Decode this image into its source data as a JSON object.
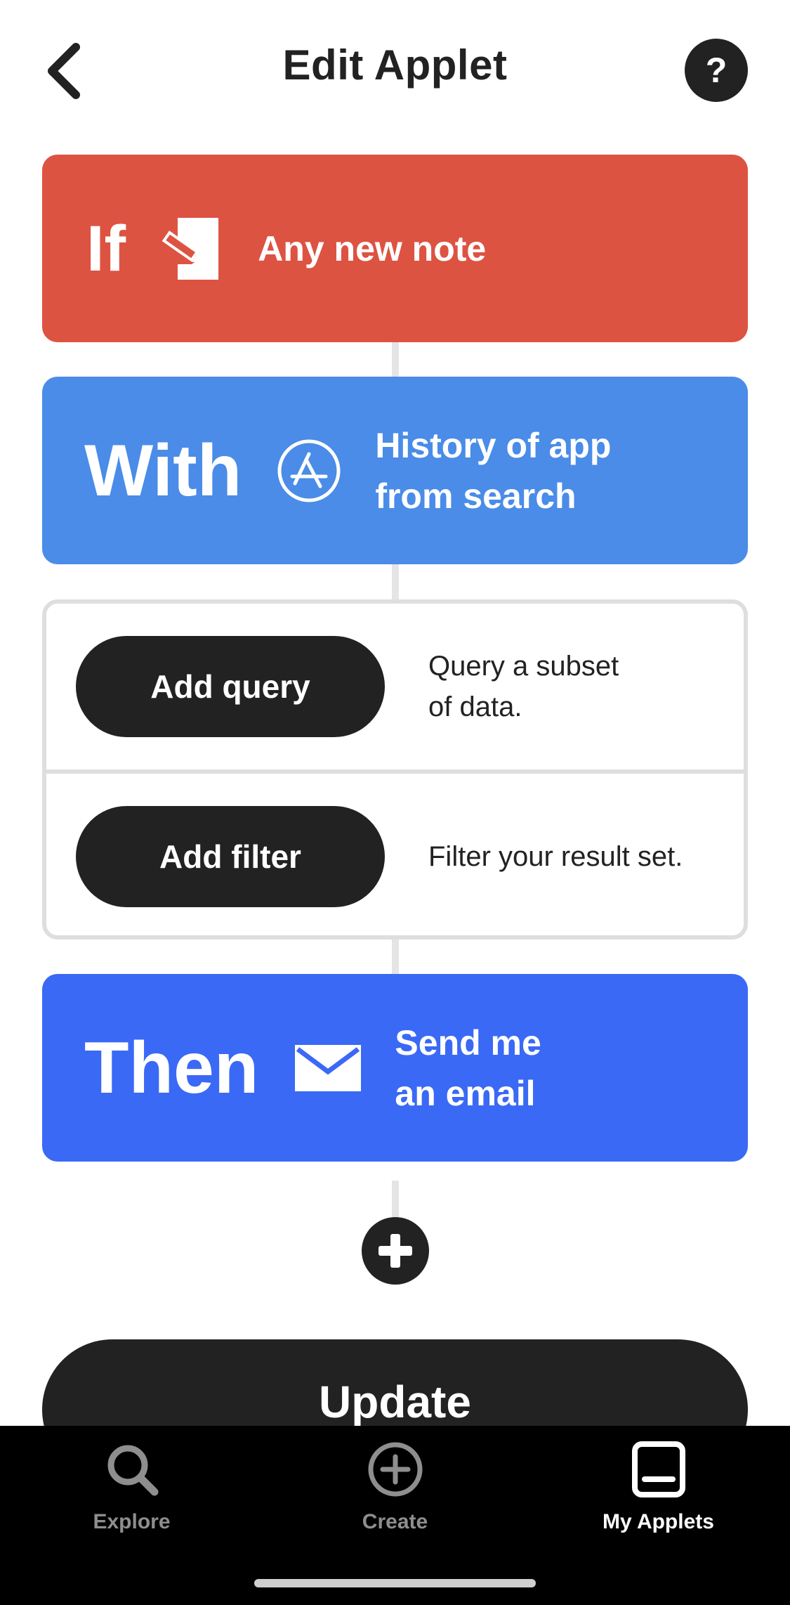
{
  "header": {
    "title": "Edit Applet",
    "help_label": "?"
  },
  "trigger": {
    "keyword": "If",
    "text": "Any new note",
    "icon": "note-pencil-icon",
    "color": "#dd5342"
  },
  "query_source": {
    "keyword": "With",
    "text_line1": "History of app",
    "text_line2": "from search",
    "icon": "app-store-icon",
    "color": "#4a8ce8"
  },
  "query_filter": {
    "add_query_label": "Add query",
    "add_query_desc_line1": "Query a subset",
    "add_query_desc_line2": "of data.",
    "add_filter_label": "Add filter",
    "add_filter_desc": "Filter your result set."
  },
  "action": {
    "keyword": "Then",
    "text_line1": "Send me",
    "text_line2": "an email",
    "icon": "email-envelope-icon",
    "color": "#3a69f5"
  },
  "add_action_icon": "plus-circle-icon",
  "update_label": "Update",
  "tab_bar": {
    "tabs": [
      {
        "label": "Explore",
        "icon": "search-icon",
        "active": false
      },
      {
        "label": "Create",
        "icon": "plus-circle-icon",
        "active": false
      },
      {
        "label": "My Applets",
        "icon": "my-applets-icon",
        "active": true
      }
    ]
  }
}
